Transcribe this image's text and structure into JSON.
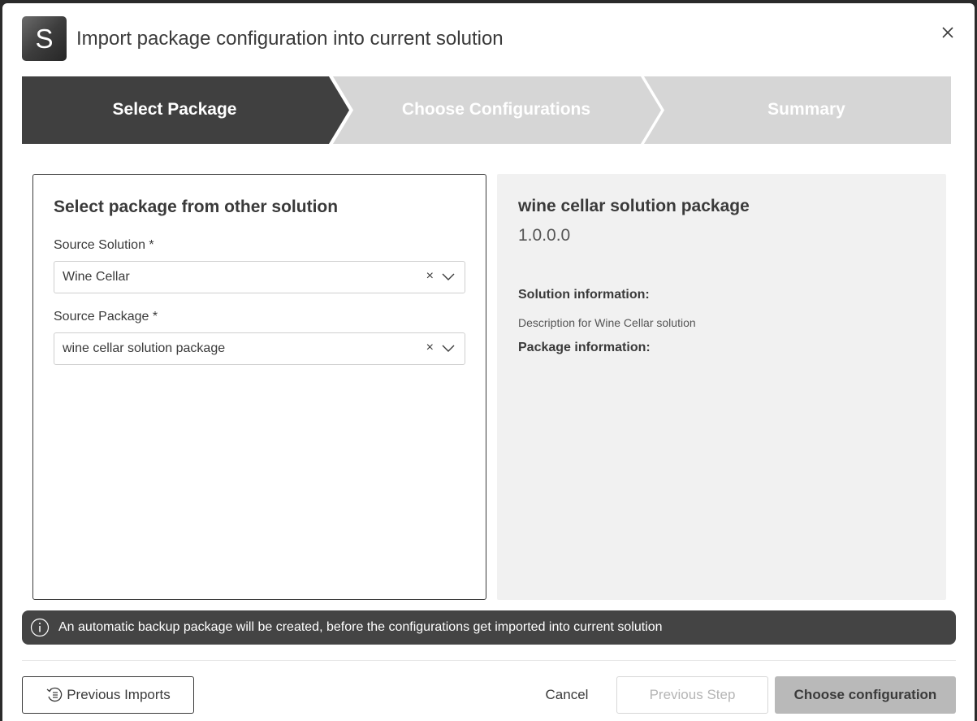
{
  "header": {
    "logo_letter": "S",
    "title": "Import package configuration into current solution"
  },
  "stepper": {
    "steps": [
      {
        "label": "Select Package",
        "state": "active"
      },
      {
        "label": "Choose Configurations",
        "state": "inactive"
      },
      {
        "label": "Summary",
        "state": "inactive"
      }
    ],
    "active_color": "#404040",
    "inactive_color": "#d6d6d6"
  },
  "left_panel": {
    "title": "Select package from other solution",
    "source_solution": {
      "label": "Source Solution *",
      "value": "Wine Cellar",
      "clear_symbol": "×"
    },
    "source_package": {
      "label": "Source Package *",
      "value": "wine cellar solution package",
      "clear_symbol": "×"
    }
  },
  "right_panel": {
    "package_name": "wine cellar solution package",
    "version": "1.0.0.0",
    "solution_info_label": "Solution information:",
    "solution_description": "Description for Wine Cellar solution",
    "package_info_label": "Package information:"
  },
  "banner": {
    "message": "An automatic backup package will be created, before the configurations get imported into current solution"
  },
  "footer": {
    "previous_imports": "Previous Imports",
    "cancel": "Cancel",
    "previous_step": "Previous Step",
    "choose_configuration": "Choose configuration"
  }
}
